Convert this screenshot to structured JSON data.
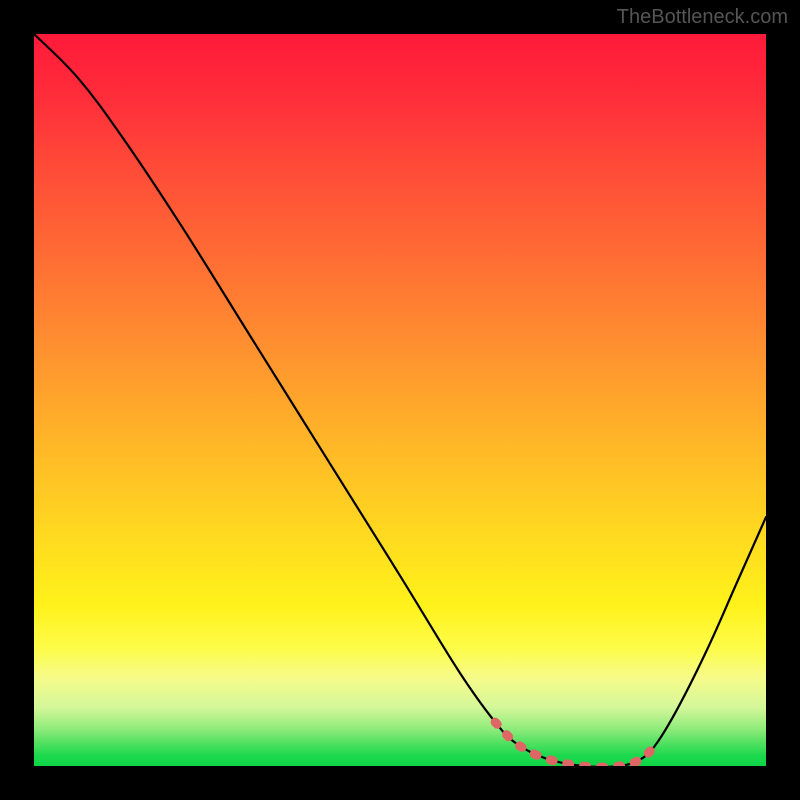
{
  "watermark": "TheBottleneck.com",
  "chart_data": {
    "type": "line",
    "title": "",
    "xlabel": "",
    "ylabel": "",
    "xlim": [
      0,
      100
    ],
    "ylim": [
      0,
      100
    ],
    "grid": false,
    "series": [
      {
        "name": "bottleneck-curve",
        "x": [
          0,
          6,
          12,
          20,
          30,
          40,
          50,
          58,
          63,
          66,
          70,
          75,
          80,
          83,
          85,
          88,
          92,
          96,
          100
        ],
        "y": [
          100,
          94,
          86,
          74,
          58,
          42,
          26,
          13,
          6,
          3,
          1,
          0,
          0,
          1,
          3,
          8,
          16,
          25,
          34
        ],
        "color": "#000000"
      },
      {
        "name": "bottom-highlight",
        "x": [
          63,
          66,
          70,
          75,
          80,
          83,
          85
        ],
        "y": [
          6,
          3,
          1,
          0,
          0,
          1,
          3
        ],
        "color": "#e06666"
      }
    ],
    "gradient_stops": [
      {
        "pos": 0,
        "color": "#ff1a3a"
      },
      {
        "pos": 50,
        "color": "#ffb428"
      },
      {
        "pos": 80,
        "color": "#fff21a"
      },
      {
        "pos": 100,
        "color": "#0bd646"
      }
    ]
  }
}
